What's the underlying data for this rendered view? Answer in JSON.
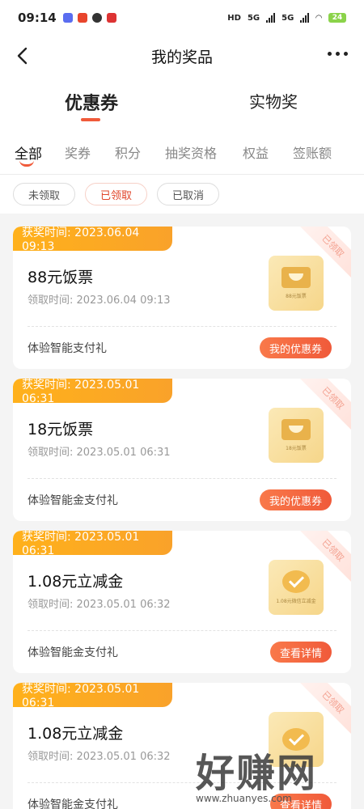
{
  "status": {
    "time": "09:14",
    "net1": "5G",
    "net2": "5G",
    "battery": "24"
  },
  "nav": {
    "title": "我的奖品"
  },
  "main_tabs": [
    "优惠券",
    "实物奖"
  ],
  "sub_tabs": [
    "全部",
    "奖券",
    "积分",
    "抽奖资格",
    "权益",
    "签账额"
  ],
  "filters": [
    "未领取",
    "已领取",
    "已取消"
  ],
  "cards": [
    {
      "award_time": "获奖时间: 2023.06.04 09:13",
      "status": "已领取",
      "name": "88元饭票",
      "receive_time": "领取时间: 2023.06.04 09:13",
      "thumb_text": "88元饭票",
      "thumb_icon": "ticket-icon",
      "gift": "体验智能支付礼",
      "button": "我的优惠券"
    },
    {
      "award_time": "获奖时间: 2023.05.01 06:31",
      "status": "已领取",
      "name": "18元饭票",
      "receive_time": "领取时间: 2023.05.01 06:31",
      "thumb_text": "18元饭票",
      "thumb_icon": "ticket-icon",
      "gift": "体验智能金支付礼",
      "button": "我的优惠券"
    },
    {
      "award_time": "获奖时间: 2023.05.01 06:31",
      "status": "已领取",
      "name": "1.08元立减金",
      "receive_time": "领取时间: 2023.05.01 06:32",
      "thumb_text": "1.08元微信立减金",
      "thumb_icon": "wechat-check-icon",
      "gift": "体验智能金支付礼",
      "button": "查看详情"
    },
    {
      "award_time": "获奖时间: 2023.05.01 06:31",
      "status": "已领取",
      "name": "1.08元立减金",
      "receive_time": "领取时间: 2023.05.01 06:32",
      "thumb_text": "",
      "thumb_icon": "wechat-check-icon",
      "gift": "体验智能金支付礼",
      "button": "查看详情"
    }
  ],
  "watermark": {
    "big": "好赚网",
    "small": "www.zhuanyes.com"
  },
  "colors": {
    "accent": "#f05a3a",
    "award_bg": "#ffb11b",
    "button": "#f9794a"
  }
}
